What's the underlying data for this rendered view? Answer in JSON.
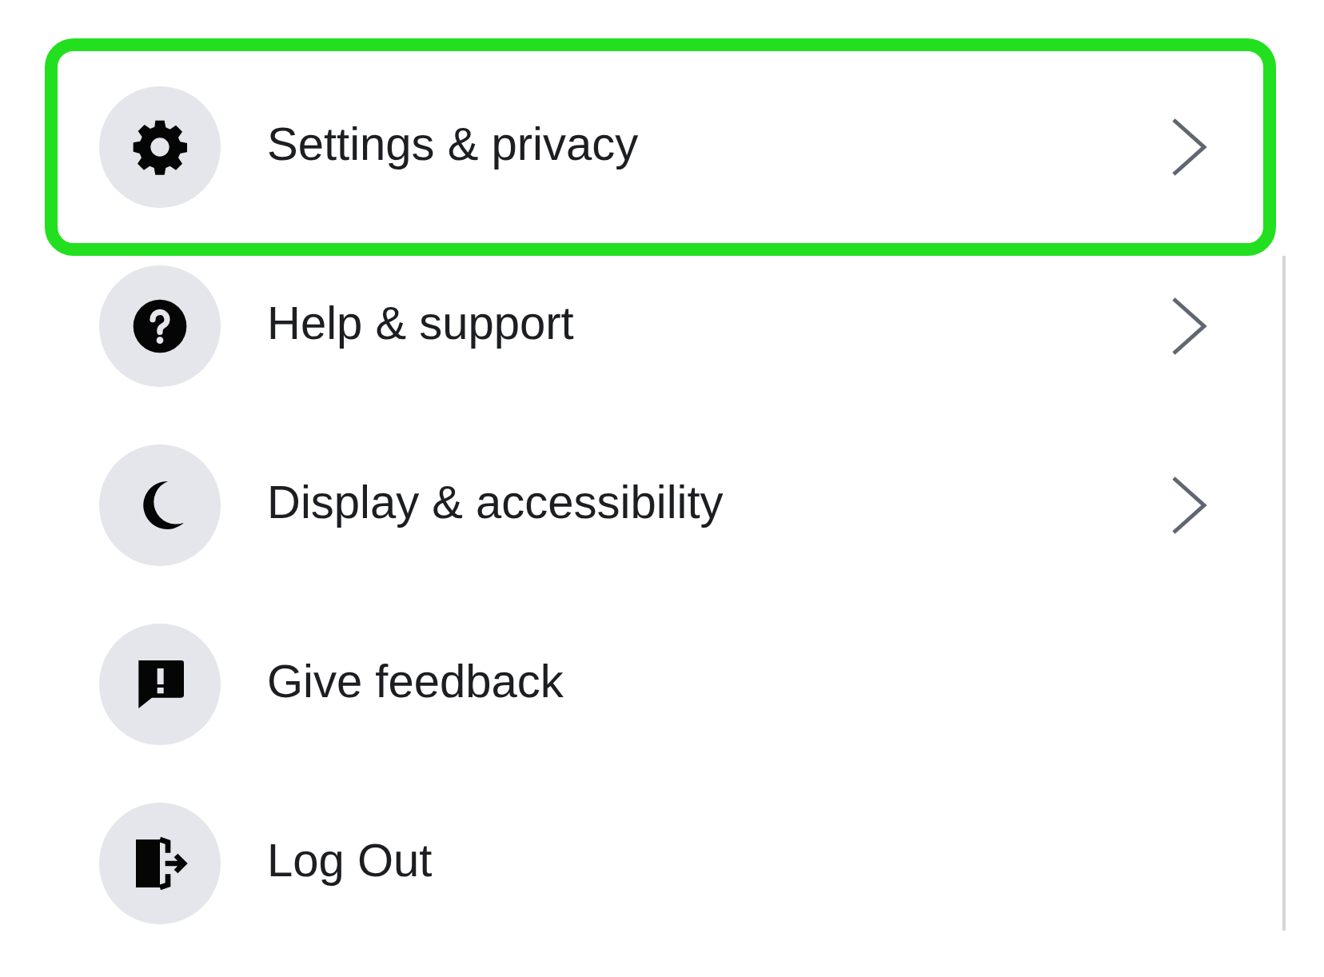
{
  "menu": {
    "items": [
      {
        "label": "Settings & privacy",
        "kind": "gear",
        "submenu": true,
        "highlighted": true
      },
      {
        "label": "Help & support",
        "kind": "help",
        "submenu": true,
        "highlighted": false
      },
      {
        "label": "Display & accessibility",
        "kind": "moon",
        "submenu": true,
        "highlighted": false
      },
      {
        "label": "Give feedback",
        "kind": "feedback",
        "submenu": false,
        "highlighted": false
      },
      {
        "label": "Log Out",
        "kind": "logout",
        "submenu": false,
        "highlighted": false
      }
    ]
  }
}
